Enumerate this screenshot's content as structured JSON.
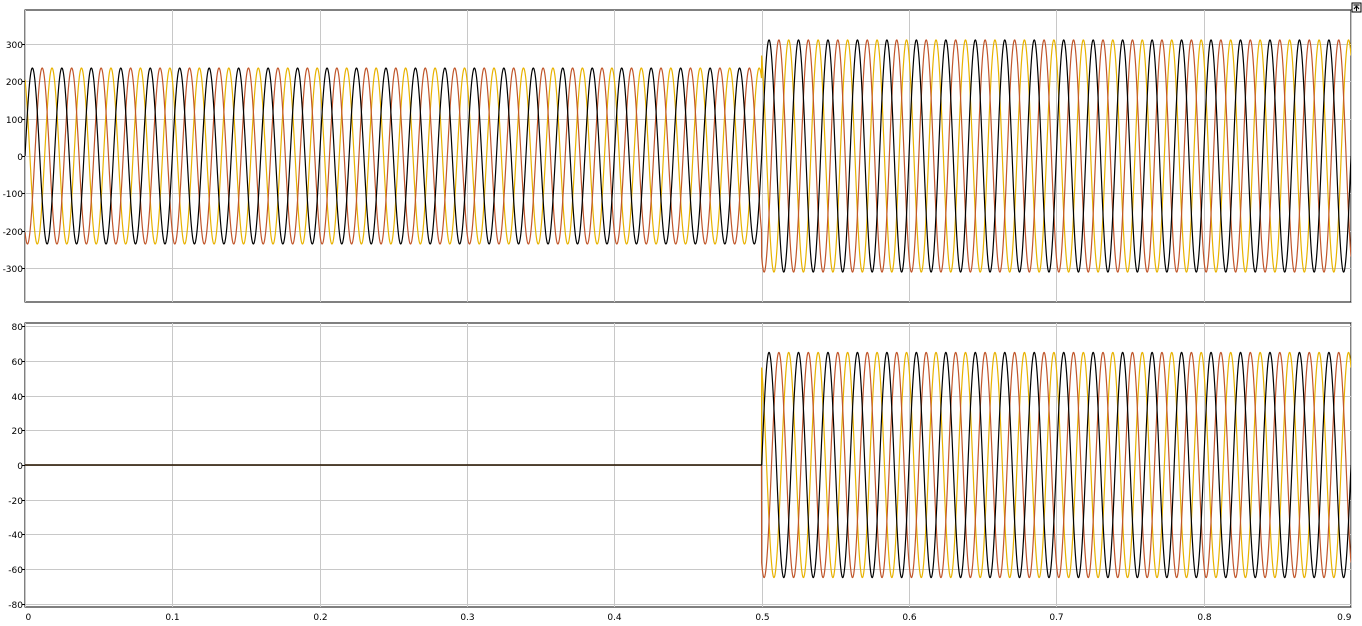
{
  "colors": {
    "background": "#ffffff",
    "axes_background": "#ffffff",
    "grid": "#c8c8c8",
    "series": [
      "#000000",
      "#c0562a",
      "#e8b200"
    ]
  },
  "toolbar": {
    "restore_icon": "restore-axes-icon"
  },
  "chart_data": [
    {
      "type": "line",
      "title": "",
      "xlabel": "",
      "ylabel": "",
      "xlim": [
        0,
        0.9
      ],
      "ylim": [
        -390,
        390
      ],
      "xticks": [
        0,
        0.1,
        0.2,
        0.3,
        0.4,
        0.5,
        0.6,
        0.7,
        0.8,
        0.9
      ],
      "xtick_labels": [
        "0",
        "0.1",
        "0.2",
        "0.3",
        "0.4",
        "0.5",
        "0.6",
        "0.7",
        "0.8",
        "0.9"
      ],
      "show_xtick_labels": false,
      "yticks": [
        -300,
        -200,
        -100,
        0,
        100,
        200,
        300
      ],
      "ytick_labels": [
        "-300",
        "-200",
        "-100",
        "0",
        "100",
        "200",
        "300"
      ],
      "grid": true,
      "legend": "none",
      "signal": "three-phase sinusoid, 50 Hz, 120° phase spacing",
      "frequency": 50,
      "segments": [
        {
          "t_start": 0,
          "t_end": 0.5,
          "amplitude": 235
        },
        {
          "t_start": 0.5,
          "t_end": 0.9,
          "amplitude": 310
        }
      ],
      "series": [
        {
          "phase_deg": 0,
          "color": "#000000"
        },
        {
          "phase_deg": -120,
          "color": "#c0562a"
        },
        {
          "phase_deg": 120,
          "color": "#e8b200"
        }
      ]
    },
    {
      "type": "line",
      "title": "",
      "xlabel": "",
      "ylabel": "",
      "xlim": [
        0,
        0.9
      ],
      "ylim": [
        -82,
        82
      ],
      "xticks": [
        0,
        0.1,
        0.2,
        0.3,
        0.4,
        0.5,
        0.6,
        0.7,
        0.8,
        0.9
      ],
      "xtick_labels": [
        "0",
        "0.1",
        "0.2",
        "0.3",
        "0.4",
        "0.5",
        "0.6",
        "0.7",
        "0.8",
        "0.9"
      ],
      "show_xtick_labels": true,
      "yticks": [
        -80,
        -60,
        -40,
        -20,
        0,
        20,
        40,
        60,
        80
      ],
      "ytick_labels": [
        "-80",
        "-60",
        "-40",
        "-20",
        "0",
        "20",
        "40",
        "60",
        "80"
      ],
      "grid": true,
      "legend": "none",
      "signal": "three-phase sinusoid, 50 Hz, 120° phase spacing",
      "frequency": 50,
      "segments": [
        {
          "t_start": 0,
          "t_end": 0.5,
          "amplitude": 0
        },
        {
          "t_start": 0.5,
          "t_end": 0.9,
          "amplitude": 65
        }
      ],
      "series": [
        {
          "phase_deg": 0,
          "color": "#000000"
        },
        {
          "phase_deg": -120,
          "color": "#c0562a"
        },
        {
          "phase_deg": 120,
          "color": "#e8b200"
        }
      ]
    }
  ]
}
